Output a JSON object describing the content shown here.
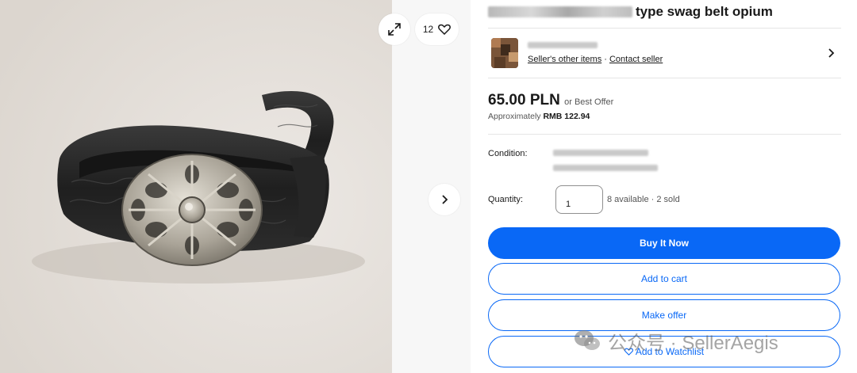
{
  "gallery": {
    "watch_count": "12",
    "expand_icon": "expand-icon",
    "heart_icon": "heart-icon",
    "next_icon": "chevron-right-icon"
  },
  "listing": {
    "title": "type swag belt opium"
  },
  "seller": {
    "links": {
      "other_items": "Seller's other items",
      "separator": " · ",
      "contact": "Contact seller"
    }
  },
  "price": {
    "amount": "65.00 PLN",
    "best_offer": "or Best Offer",
    "approx_label": "Approximately",
    "approx_value": "RMB 122.94"
  },
  "condition": {
    "label": "Condition:"
  },
  "quantity": {
    "label": "Quantity:",
    "value": "1",
    "availability": "8 available · 2 sold"
  },
  "actions": {
    "buy_now": "Buy It Now",
    "add_to_cart": "Add to cart",
    "make_offer": "Make offer",
    "add_to_watchlist": "Add to Watchlist"
  },
  "watermark": {
    "text": "公众号 · SellerAegis"
  },
  "colors": {
    "primary": "#0968f6",
    "text": "#191919",
    "muted": "#555555"
  }
}
